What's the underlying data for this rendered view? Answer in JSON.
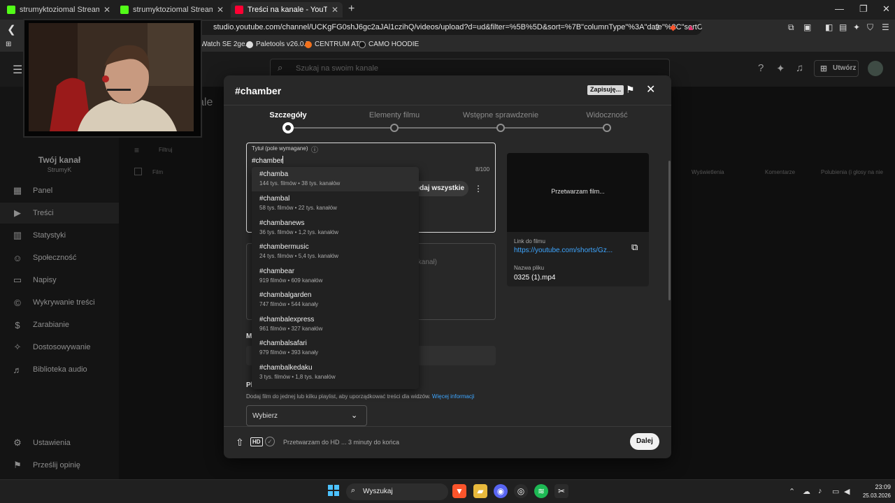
{
  "browser": {
    "tabs": [
      {
        "title": "strumyktoziomal Stream - Watch Live",
        "active": false
      },
      {
        "title": "strumyktoziomal Stream - Watch Live",
        "active": false
      },
      {
        "title": "Treści na kanale - YouTube Studio",
        "active": true
      }
    ],
    "address": "studio.youtube.com/channel/UCKgFG0shJ6gc2aJAl1czihQ/videos/upload?d=ud&filter=%5B%5D&sort=%7B\"columnType\"%3A\"date\"%2C\"sortOrder\"...",
    "bookmarks": [
      "Watch SE 2ge...",
      "Paletools v26.0.7",
      "CENTRUM ATK",
      "CAMO HOODIE"
    ]
  },
  "studio": {
    "search_placeholder": "Szukaj na swoim kanale",
    "create_label": "Utwórz",
    "channel_name": "Twój kanał",
    "channel_handle": "StrumyK",
    "background_title": "ale",
    "nav_items": [
      {
        "label": "Panel",
        "icon": "dashboard-icon"
      },
      {
        "label": "Treści",
        "icon": "content-icon",
        "selected": true
      },
      {
        "label": "Statystyki",
        "icon": "analytics-icon"
      },
      {
        "label": "Społeczność",
        "icon": "community-icon"
      },
      {
        "label": "Napisy",
        "icon": "subtitles-icon"
      },
      {
        "label": "Wykrywanie treści",
        "icon": "copyright-icon"
      },
      {
        "label": "Zarabianie",
        "icon": "monetization-icon"
      },
      {
        "label": "Dostosowywanie",
        "icon": "customization-icon"
      },
      {
        "label": "Biblioteka audio",
        "icon": "audio-library-icon"
      }
    ],
    "bottom_nav": [
      {
        "label": "Ustawienia",
        "icon": "settings-icon"
      },
      {
        "label": "Prześlij opinię",
        "icon": "feedback-icon"
      }
    ],
    "table_headers": [
      "Wyświetlenia",
      "Komentarze",
      "Polubienia (i głosy na nie"
    ],
    "filter_label": "Filtruj",
    "film_label": "Film"
  },
  "modal": {
    "title": "#chamber",
    "saving_badge": "Zapisuję...",
    "steps": [
      {
        "label": "Szczegóły",
        "active": true
      },
      {
        "label": "Elementy filmu",
        "active": false
      },
      {
        "label": "Wstępne sprawdzenie",
        "active": false
      },
      {
        "label": "Widoczność",
        "active": false
      }
    ],
    "title_field": {
      "label": "Tytuł (pole wymagane)",
      "value": "#chamber",
      "counter": "8/100",
      "add_all_label": "odaj wszystkie"
    },
    "description_placeholder": "ć kanał)",
    "thumbnail_heading": "M",
    "playlist": {
      "heading": "Pl",
      "description": "Dodaj film do jednej lub kilku playlist, aby uporządkować treści dla widzów.",
      "link": "Więcej informacji",
      "select_value": "Wybierz"
    },
    "preview": {
      "processing": "Przetwarzam film...",
      "link_label": "Link do filmu",
      "link_value": "https://youtube.com/shorts/Gz...",
      "file_label": "Nazwa pliku",
      "file_value": "0325 (1).mp4"
    },
    "footer_status": "Przetwarzam do HD ... 3 minuty do końca",
    "next_label": "Dalej",
    "suggestions": [
      {
        "tag": "#chamba",
        "meta": "144 tys. filmów • 38 tys. kanałów"
      },
      {
        "tag": "#chambal",
        "meta": "58 tys. filmów • 22 tys. kanałów"
      },
      {
        "tag": "#chambanews",
        "meta": "36 tys. filmów • 1,2 tys. kanałów"
      },
      {
        "tag": "#chambermusic",
        "meta": "24 tys. filmów • 5,4 tys. kanałów"
      },
      {
        "tag": "#chambear",
        "meta": "919 filmów • 609 kanałów"
      },
      {
        "tag": "#chambalgarden",
        "meta": "747 filmów • 544 kanały"
      },
      {
        "tag": "#chambalexpress",
        "meta": "961 filmów • 327 kanałów"
      },
      {
        "tag": "#chambalsafari",
        "meta": "979 filmów • 393 kanały"
      },
      {
        "tag": "#chambalkedaku",
        "meta": "3 tys. filmów • 1,8 tys. kanałów"
      }
    ]
  },
  "taskbar": {
    "search_label": "Wyszukaj",
    "time": "23:09",
    "date": "25.03.2026"
  }
}
